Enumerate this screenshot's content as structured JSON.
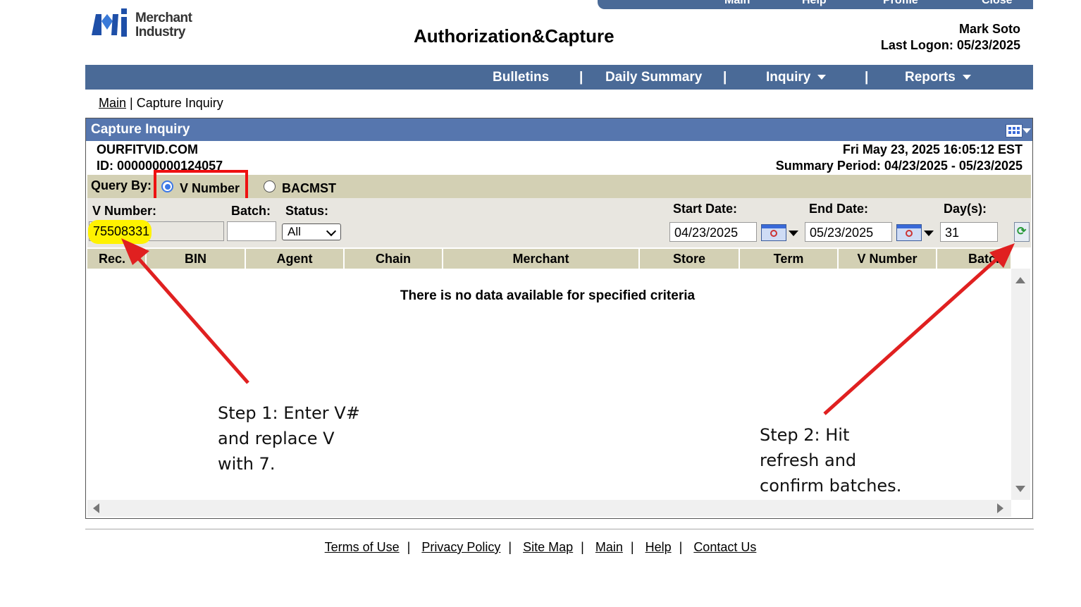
{
  "top_nav": {
    "items": [
      "Main",
      "Help",
      "Profile",
      "Close"
    ]
  },
  "logo": {
    "line1": "Merchant",
    "line2": "Industry"
  },
  "header": {
    "title": "Authorization&Capture",
    "user_name": "Mark Soto",
    "last_logon": "Last Logon: 05/23/2025"
  },
  "menu": {
    "items": [
      {
        "label": "Bulletins"
      },
      {
        "label": "Daily Summary"
      },
      {
        "label": "Inquiry"
      },
      {
        "label": "Reports"
      }
    ],
    "separator": "|"
  },
  "breadcrumb": {
    "main": "Main",
    "separator": "|",
    "current": "Capture Inquiry"
  },
  "panel": {
    "title": "Capture Inquiry",
    "merchant_name": "OURFITVID.COM",
    "merchant_id": "ID: 000000000124057",
    "datetime": "Fri May 23, 2025 16:05:12 EST",
    "summary_period": "Summary Period: 04/23/2025 - 05/23/2025"
  },
  "query": {
    "label": "Query By:",
    "option_v": "V Number",
    "option_bac": "BACMST",
    "selected": "V Number"
  },
  "filters": {
    "v_number_label": "V Number:",
    "v_number_value": "75508331",
    "batch_label": "Batch:",
    "batch_value": "",
    "status_label": "Status:",
    "status_value": "All",
    "start_label": "Start Date:",
    "start_value": "04/23/2025",
    "end_label": "End Date:",
    "end_value": "05/23/2025",
    "days_label": "Day(s):",
    "days_value": "31"
  },
  "table": {
    "columns": [
      "Rec.",
      "BIN",
      "Agent",
      "Chain",
      "Merchant",
      "Store",
      "Term",
      "V Number",
      "Batch"
    ],
    "empty_message": "There is no data available for specified criteria"
  },
  "annotations": {
    "step1": [
      "Step 1: Enter V#",
      "and replace V",
      "with 7."
    ],
    "step2": [
      "Step 2: Hit",
      "refresh and",
      "confirm batches."
    ],
    "color": "#e02020",
    "highlight_color": "#fff200"
  },
  "footer": {
    "links": [
      "Terms of Use",
      "Privacy Policy",
      "Site Map",
      "Main",
      "Help",
      "Contact Us"
    ],
    "separator": "|"
  },
  "colors": {
    "nav_blue": "#4a6a97",
    "panel_header": "#5676ae",
    "row_tan": "#d3d0b4"
  }
}
